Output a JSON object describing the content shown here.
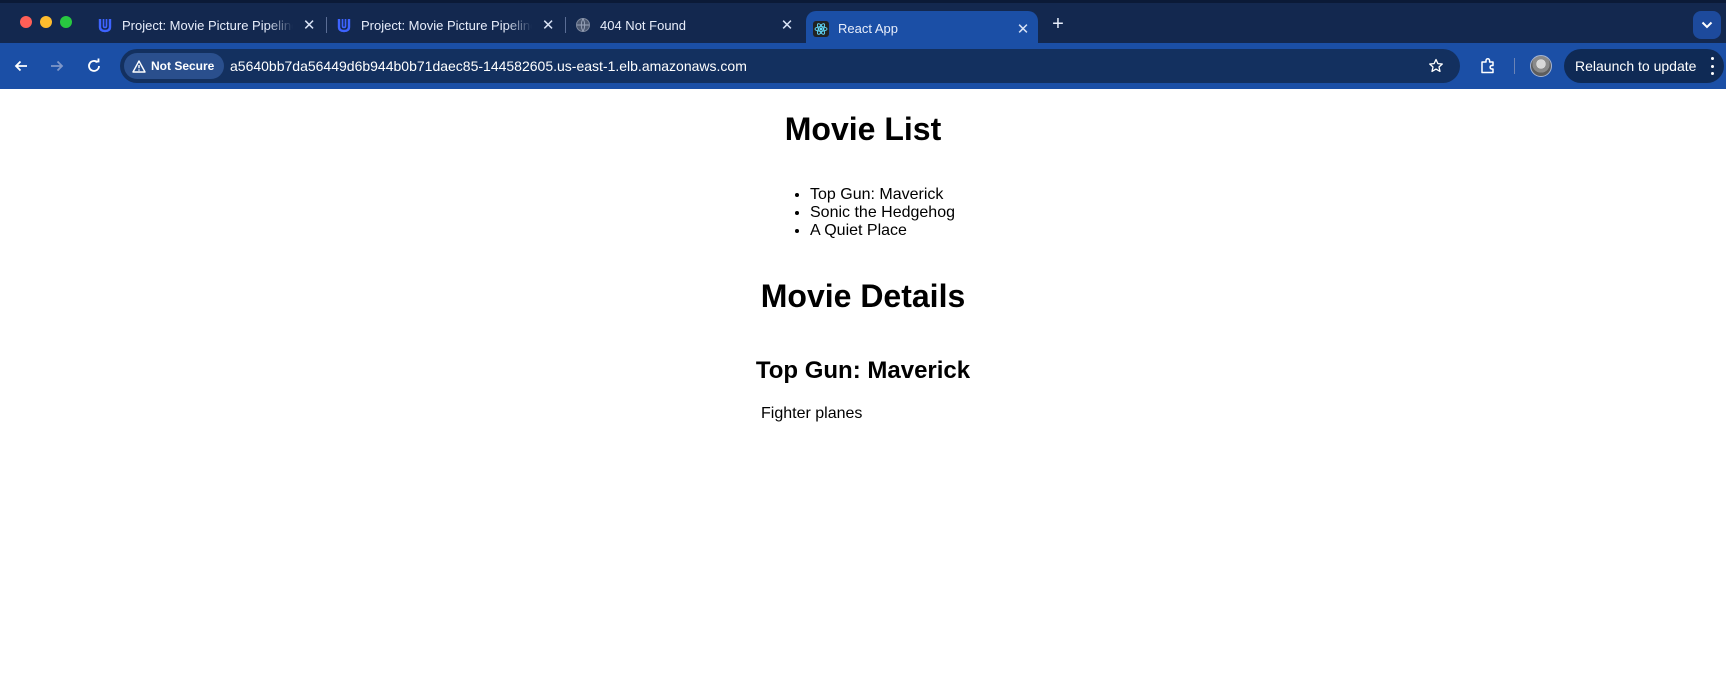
{
  "browser": {
    "tabs": [
      {
        "title": "Project: Movie Picture Pipeline",
        "favicon": "udacity-icon",
        "active": false
      },
      {
        "title": "Project: Movie Picture Pipeline",
        "favicon": "udacity-icon",
        "active": false
      },
      {
        "title": "404 Not Found",
        "favicon": "globe-icon",
        "active": false
      },
      {
        "title": "React App",
        "favicon": "react-icon",
        "active": true
      }
    ],
    "security_label": "Not Secure",
    "url": "a5640bb7da56449d6b944b0b71daec85-144582605.us-east-1.elb.amazonaws.com",
    "relaunch_label": "Relaunch to update",
    "colors": {
      "tabbar": "#13284f",
      "toolbar": "#1b4fa6",
      "omnibox": "#13305f"
    }
  },
  "page": {
    "list_heading": "Movie List",
    "movies": [
      "Top Gun: Maverick",
      "Sonic the Hedgehog",
      "A Quiet Place"
    ],
    "details_heading": "Movie Details",
    "selected_title": "Top Gun: Maverick",
    "selected_description": "Fighter planes"
  }
}
